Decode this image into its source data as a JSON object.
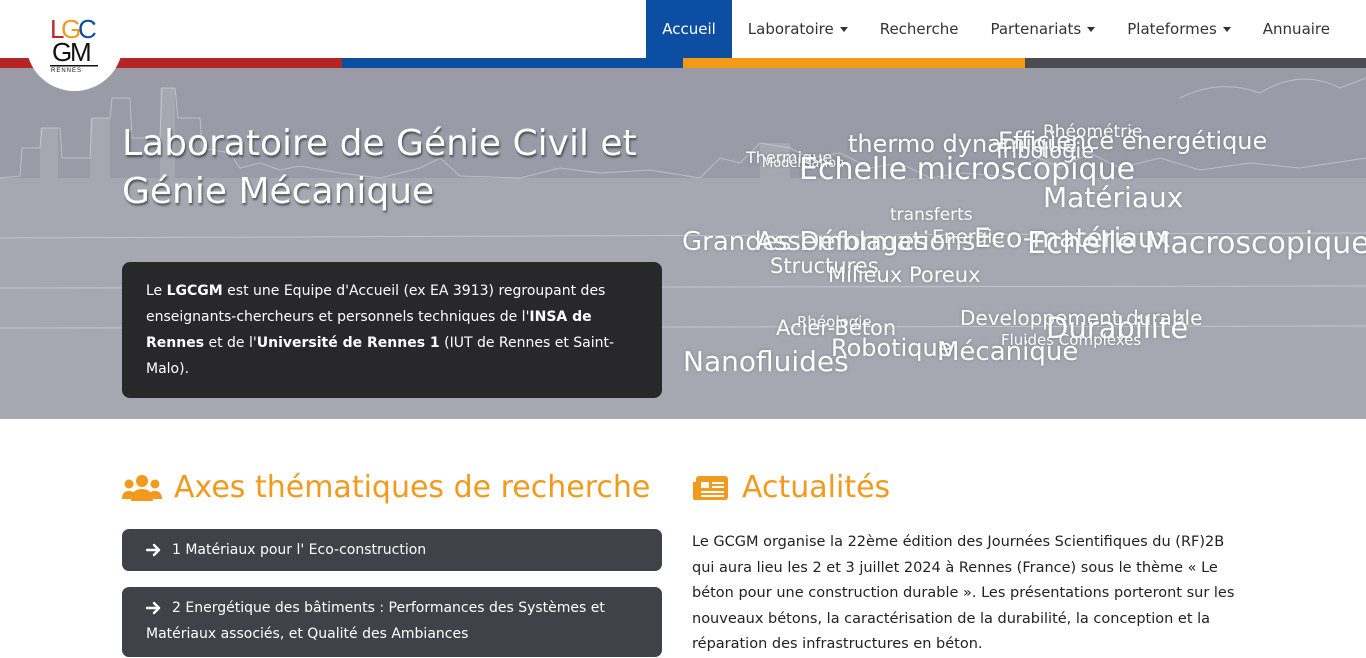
{
  "nav": {
    "logo_alt": "LGCGM Rennes",
    "items": [
      {
        "label": "Accueil",
        "active": true,
        "dropdown": false
      },
      {
        "label": "Laboratoire",
        "active": false,
        "dropdown": true
      },
      {
        "label": "Recherche",
        "active": false,
        "dropdown": false
      },
      {
        "label": "Partenariats",
        "active": false,
        "dropdown": true
      },
      {
        "label": "Plateformes",
        "active": false,
        "dropdown": true
      },
      {
        "label": "Annuaire",
        "active": false,
        "dropdown": false
      }
    ]
  },
  "colors": {
    "stripe_red": "#b62525",
    "stripe_blue": "#0b4ea2",
    "stripe_orange": "#f49a17",
    "stripe_gray": "#4a4c52",
    "accent": "#f29a1d",
    "nav_active": "#0b4ea2"
  },
  "hero": {
    "title": "Laboratoire de Génie Civil et Génie Mécanique",
    "intro": {
      "p1": "Le ",
      "b1": "LGCGM",
      "p2": " est une Equipe d'Accueil (ex EA 3913) regroupant des enseignants-chercheurs et personnels techniques de l'",
      "b2": "INSA de Rennes",
      "p3": " et de l'",
      "b3": "Université de Rennes 1",
      "p4": " (IUT de Rennes et Saint-Malo)."
    },
    "word_cloud": [
      "Rhéométrie",
      "thermo dynamique",
      "Efficience énergétique",
      "Thermique",
      "Modélisation",
      "Tribologie",
      "Echelle microscopique",
      "Matériaux",
      "transferts",
      "Grandes Déformations",
      "Assemblages",
      "Energie",
      "Eco-matériaux",
      "Echelle Macroscopique",
      "Structures",
      "Milieux Poreux",
      "Developpement durable",
      "Rhéologie",
      "Durabilité",
      "Acier-Béton",
      "Fluides Complexes",
      "Robotique",
      "Mécanique",
      "Nanofluides"
    ]
  },
  "axes": {
    "title": "Axes thématiques de recherche",
    "icon": "users-icon",
    "items": [
      "1 Matériaux pour l' Eco-construction",
      "2 Energétique des bâtiments : Performances des Systèmes et Matériaux associés, et Qualité des Ambiances"
    ]
  },
  "news": {
    "title": "Actualités",
    "icon": "newspaper-icon",
    "text": "Le GCGM organise la 22ème édition des Journées Scientifiques du (RF)2B qui aura lieu les 2 et 3 juillet 2024 à Rennes (France) sous le thème « Le béton pour une construction durable ». Les présentations porteront sur les nouveaux bétons, la caractérisation de la durabilité, la conception et la réparation des infrastructures en béton."
  }
}
